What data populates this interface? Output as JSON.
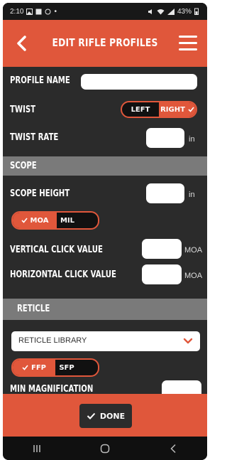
{
  "status_bar": {
    "time": "2:10",
    "battery": "43%"
  },
  "header": {
    "title": "EDIT RIFLE PROFILES"
  },
  "form": {
    "profile_name": {
      "label": "PROFILE NAME",
      "value": ""
    },
    "twist": {
      "label": "TWIST",
      "options": [
        "LEFT",
        "RIGHT"
      ],
      "selected": "RIGHT"
    },
    "twist_rate": {
      "label": "TWIST RATE",
      "value": "",
      "unit": "in"
    }
  },
  "scope": {
    "title": "SCOPE",
    "scope_height": {
      "label": "SCOPE HEIGHT",
      "value": "",
      "unit": "in"
    },
    "units_toggle": {
      "options": [
        "MOA",
        "MIL"
      ],
      "selected": "MOA"
    },
    "vertical_click": {
      "label": "VERTICAL CLICK VALUE",
      "value": "",
      "unit": "MOA"
    },
    "horizontal_click": {
      "label": "HORIZONTAL CLICK VALUE",
      "value": "",
      "unit": "MOA"
    }
  },
  "reticle": {
    "title": "RETICLE",
    "library": {
      "selected": "RETICLE LIBRARY"
    },
    "plane_toggle": {
      "options": [
        "FFP",
        "SFP"
      ],
      "selected": "FFP"
    },
    "min_magnification": {
      "label": "MIN MAGNIFICATION",
      "value": ""
    }
  },
  "footer": {
    "done_label": "DONE"
  },
  "colors": {
    "accent": "#e0573b",
    "background": "#2b2b2b",
    "section": "#7a7a7a"
  }
}
